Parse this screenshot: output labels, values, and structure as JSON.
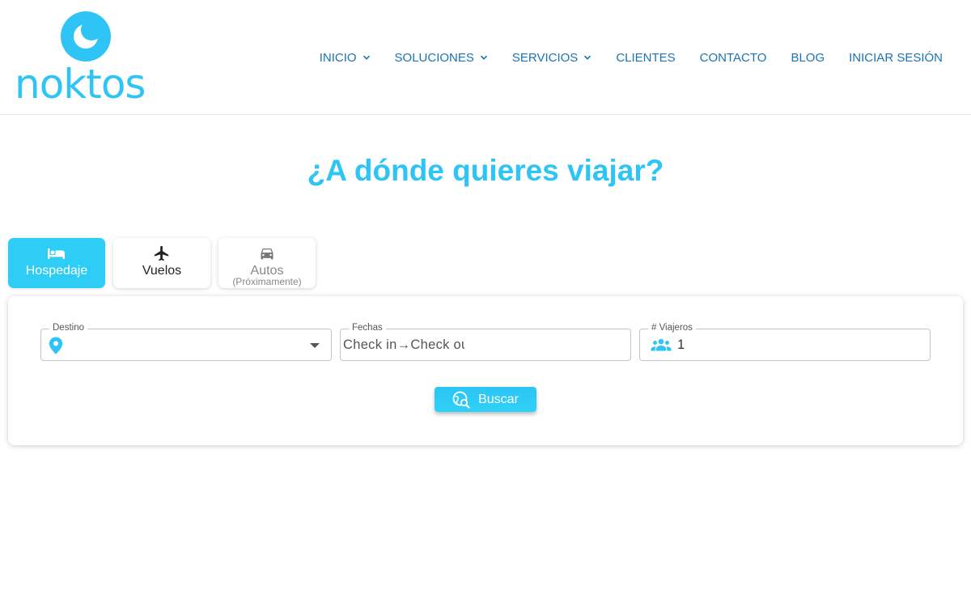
{
  "brand": {
    "name": "noktos",
    "color": "#2ec4f5"
  },
  "nav": {
    "items": [
      {
        "label": "INICIO",
        "dropdown": true
      },
      {
        "label": "SOLUCIONES",
        "dropdown": true
      },
      {
        "label": "SERVICIOS",
        "dropdown": true
      },
      {
        "label": "CLIENTES",
        "dropdown": false
      },
      {
        "label": "CONTACTO",
        "dropdown": false
      },
      {
        "label": "BLOG",
        "dropdown": false
      },
      {
        "label": "INICIAR SESIÓN",
        "dropdown": false
      }
    ],
    "color": "#1b73b3"
  },
  "hero": {
    "title": "¿A dónde quieres viajar?"
  },
  "tabs": [
    {
      "label": "Hospedaje",
      "icon": "bed-icon",
      "active": true
    },
    {
      "label": "Vuelos",
      "icon": "airplane-icon",
      "active": false
    },
    {
      "label": "Autos",
      "sublabel": "(Próximamente)",
      "icon": "car-icon",
      "active": false,
      "disabled": true
    }
  ],
  "search": {
    "destino": {
      "label": "Destino",
      "value": ""
    },
    "fechas": {
      "label": "Fechas",
      "value": "Check in→Check out"
    },
    "viajeros": {
      "label": "# Viajeros",
      "value": "1"
    },
    "button_label": "Buscar"
  },
  "colors": {
    "accent": "#2ec4f5",
    "tab_active": "#2ecdf5"
  }
}
